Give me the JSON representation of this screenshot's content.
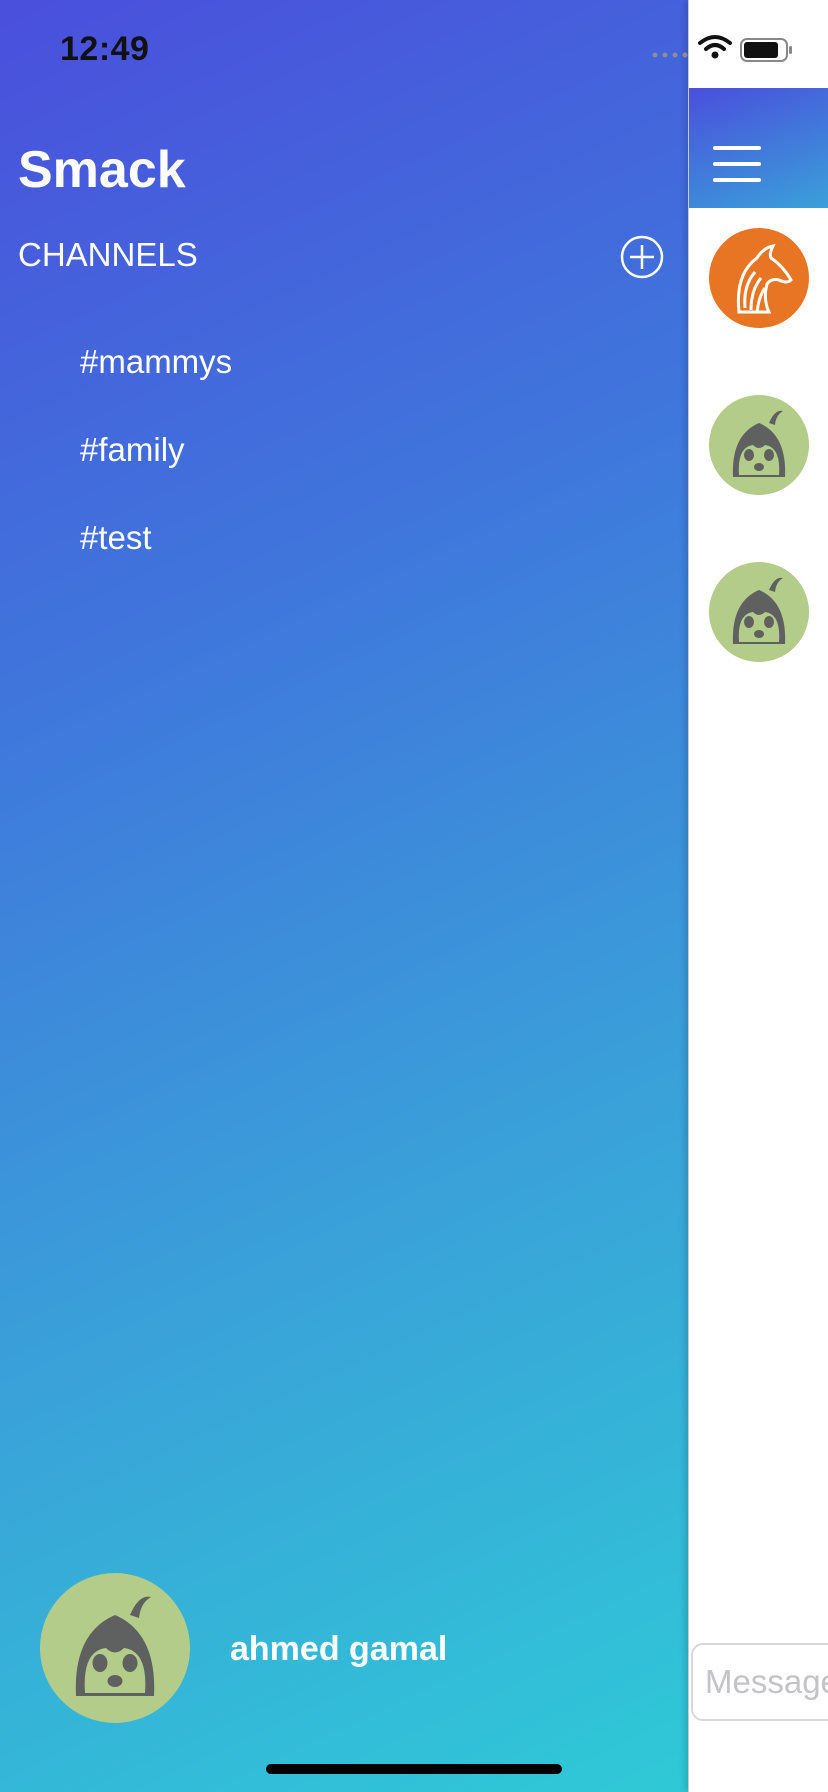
{
  "status_bar": {
    "time": "12:49",
    "wifi_icon": "wifi-icon",
    "battery_icon": "battery-icon"
  },
  "side_menu": {
    "app_title": "Smack",
    "channels_label": "CHANNELS",
    "add_channel_icon": "plus-circle-icon",
    "channels": [
      {
        "name": "#mammys"
      },
      {
        "name": "#family"
      },
      {
        "name": "#test"
      }
    ],
    "user": {
      "name": "ahmed gamal",
      "avatar": "penguin-avatar"
    }
  },
  "chat": {
    "menu_icon": "hamburger-icon",
    "message_avatars": [
      "horse-avatar",
      "penguin-avatar",
      "penguin-avatar"
    ],
    "message_input_placeholder": "Message"
  },
  "colors": {
    "gradient_start": "#4a4fdc",
    "gradient_end": "#2fc9d7",
    "avatar_green": "#b3cc8a",
    "avatar_orange": "#e87523"
  }
}
